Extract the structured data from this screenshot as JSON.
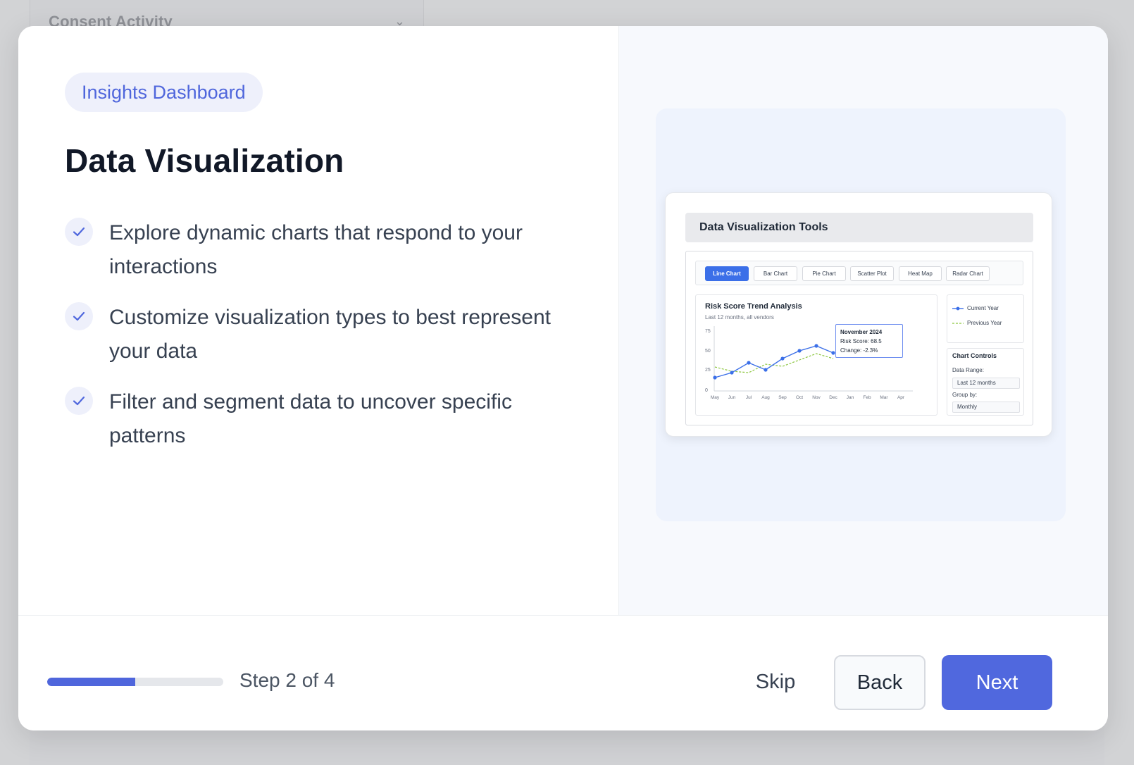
{
  "background": {
    "card_title": "Consent Activity"
  },
  "modal": {
    "badge": "Insights Dashboard",
    "title": "Data Visualization",
    "features": [
      "Explore dynamic charts that respond to your interactions",
      "Customize visualization types to best represent your data",
      "Filter and segment data to uncover specific patterns"
    ],
    "preview": {
      "header": "Data Visualization Tools",
      "tabs": [
        "Line Chart",
        "Bar Chart",
        "Pie Chart",
        "Scatter Plot",
        "Heat Map",
        "Radar Chart"
      ],
      "active_tab": "Line Chart",
      "chart_title": "Risk Score Trend Analysis",
      "chart_subtitle": "Last 12 months, all vendors",
      "y_ticks": [
        "75",
        "50",
        "25",
        "0"
      ],
      "x_ticks": [
        "May",
        "Jun",
        "Jul",
        "Aug",
        "Sep",
        "Oct",
        "Nov",
        "Dec",
        "Jan",
        "Feb",
        "Mar",
        "Apr"
      ],
      "tooltip": {
        "title": "November 2024",
        "line1": "Risk Score: 68.5",
        "line2": "Change: -2.3%"
      },
      "legend": {
        "current": "Current Year",
        "previous": "Previous Year"
      },
      "controls": {
        "title": "Chart Controls",
        "range_label": "Data Range:",
        "range_value": "Last 12 months",
        "group_label": "Group by:",
        "group_value": "Monthly"
      },
      "colors": {
        "current": "#3b6fe8",
        "previous": "#8cc63f"
      }
    },
    "footer": {
      "step_text": "Step 2 of 4",
      "progress_fraction": 0.5,
      "skip": "Skip",
      "back": "Back",
      "next": "Next"
    }
  }
}
